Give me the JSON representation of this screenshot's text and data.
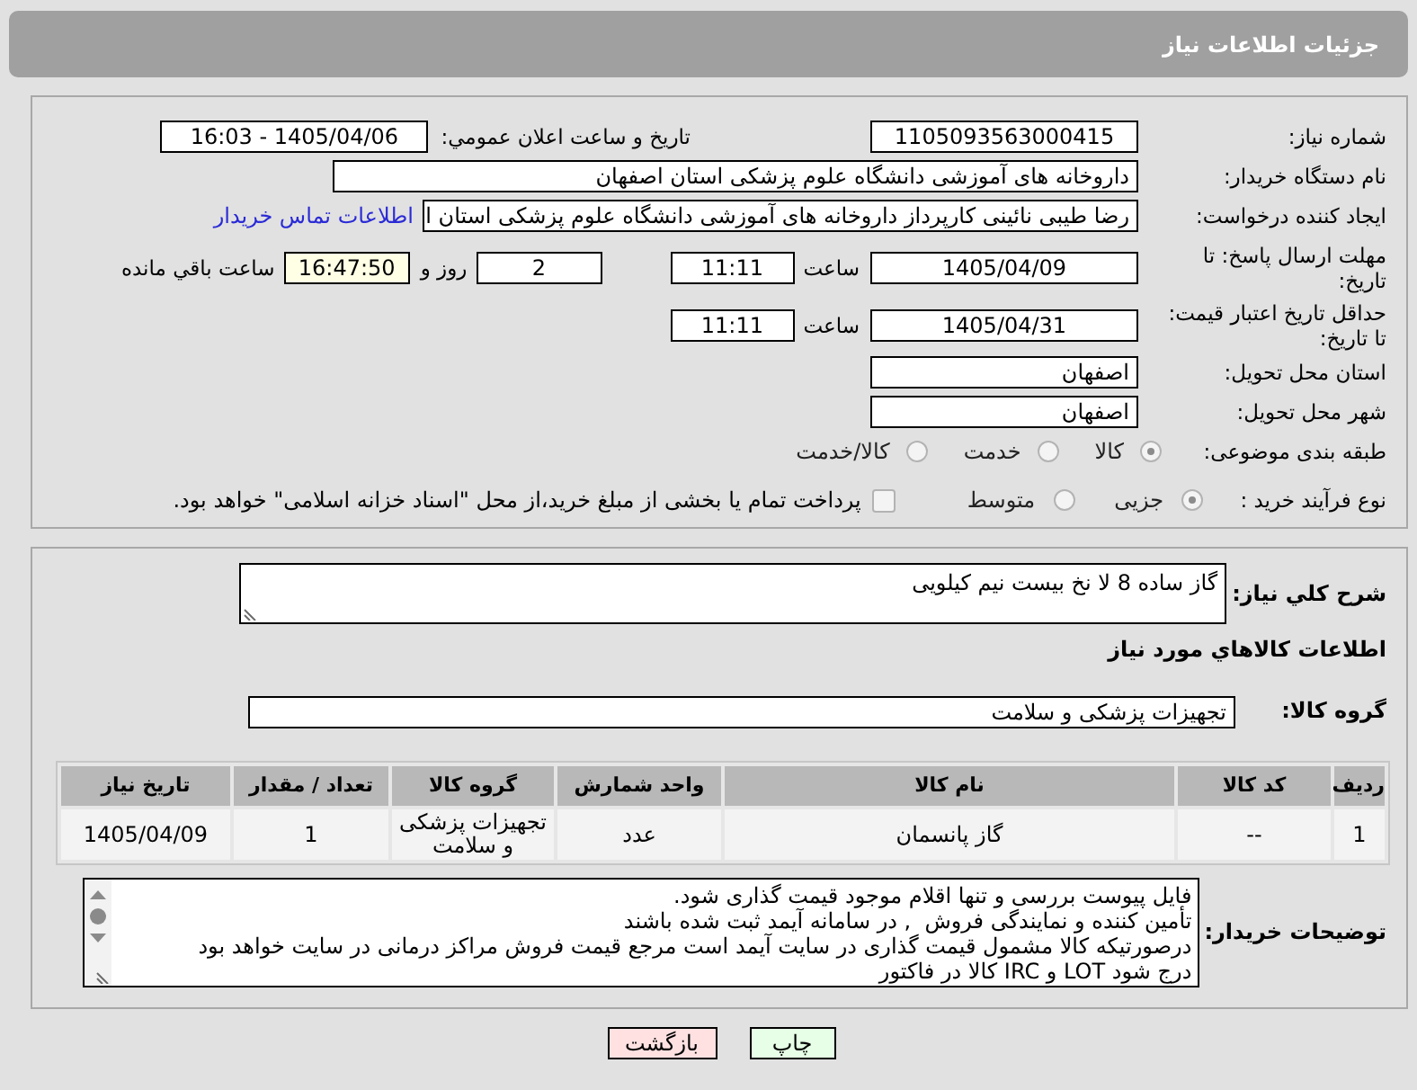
{
  "header": {
    "title": "جزئیات اطلاعات نیاز"
  },
  "details": {
    "need_number": {
      "label": "شماره نیاز:",
      "value": "1105093563000415"
    },
    "announcement": {
      "label": "تاریخ و ساعت اعلان عمومي:",
      "value": "1405/04/06 - 16:03"
    },
    "buyer_org": {
      "label": "نام دستگاه خریدار:",
      "value": "داروخانه های آموزشی دانشگاه علوم پزشکی استان اصفهان"
    },
    "requester": {
      "label": "ایجاد کننده درخواست:",
      "value": "رضا طیبی نائینی کارپرداز داروخانه های آموزشی دانشگاه علوم پزشکی استان ا",
      "contact_link": "اطلاعات تماس خریدار"
    },
    "response_deadline": {
      "label": "مهلت ارسال پاسخ: تا تاریخ:",
      "date": "1405/04/09",
      "time_label": "ساعت",
      "time": "11:11",
      "days": "2",
      "days_label": "روز و",
      "remaining": "16:47:50",
      "remaining_label": "ساعت باقي مانده"
    },
    "price_validity": {
      "label": "حداقل تاریخ اعتبار قیمت: تا تاریخ:",
      "date": "1405/04/31",
      "time_label": "ساعت",
      "time": "11:11"
    },
    "delivery_province": {
      "label": "استان محل تحویل:",
      "value": "اصفهان"
    },
    "delivery_city": {
      "label": "شهر محل تحویل:",
      "value": "اصفهان"
    },
    "category": {
      "label": "طبقه بندی موضوعی:",
      "options": [
        {
          "label": "کالا",
          "selected": true
        },
        {
          "label": "خدمت",
          "selected": false
        },
        {
          "label": "کالا/خدمت",
          "selected": false
        }
      ]
    },
    "purchase_type": {
      "label": "نوع فرآیند خرید :",
      "options": [
        {
          "label": "جزیی",
          "selected": true
        },
        {
          "label": "متوسط",
          "selected": false
        }
      ],
      "treasury_payment": {
        "label": "پرداخت تمام یا بخشی از مبلغ خرید،از محل \"اسناد خزانه اسلامی\" خواهد بود.",
        "checked": false
      }
    }
  },
  "items": {
    "summary": {
      "label": "شرح کلي نياز:",
      "value": "گاز ساده 8 لا نخ بیست نیم کیلویی"
    },
    "heading": "اطلاعات کالاهاي مورد نياز",
    "group": {
      "label": "گروه کالا:",
      "value": "تجهیزات پزشکی و سلامت"
    },
    "table": {
      "columns": [
        "ردیف",
        "کد کالا",
        "نام کالا",
        "واحد شمارش",
        "گروه کالا",
        "تعداد / مقدار",
        "تاریخ نیاز"
      ],
      "rows": [
        [
          "1",
          "--",
          "گاز پانسمان",
          "عدد",
          "تجهیزات پزشکی و سلامت",
          "1",
          "1405/04/09"
        ]
      ]
    },
    "buyer_notes": {
      "label": "توضیحات خریدار:",
      "lines": [
        "فایل پیوست بررسی و تنها اقلام موجود قیمت گذاری شود.",
        "تأمین کننده و نمایندگی فروش  , در سامانه آیمد ثبت شده باشند",
        "درصورتیکه کالا مشمول قیمت گذاری در سایت آیمد است مرجع قیمت فروش مراکز درمانی در سایت خواهد بود",
        "درج شود LOT و IRC کالا در فاکتور"
      ]
    }
  },
  "buttons": [
    {
      "label": "چاپ",
      "kind": "print"
    },
    {
      "label": "بازگشت",
      "kind": "back"
    }
  ]
}
